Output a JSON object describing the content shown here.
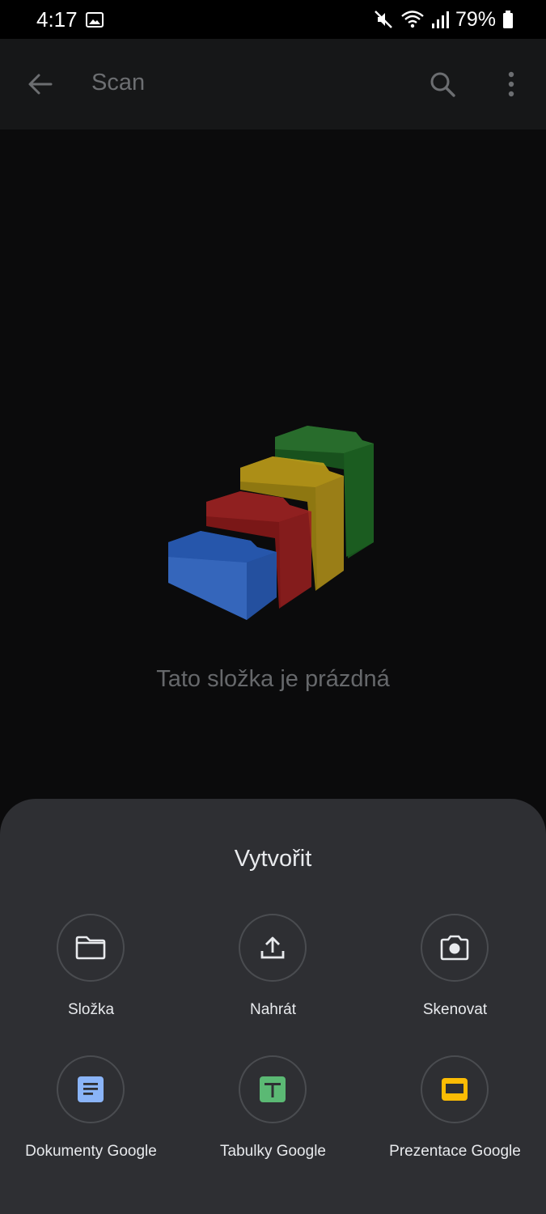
{
  "status_bar": {
    "time": "4:17",
    "battery": "79%",
    "icons": [
      "image-icon",
      "mute-icon",
      "wifi-icon",
      "signal-icon",
      "battery-icon"
    ]
  },
  "app_bar": {
    "title": "Scan",
    "icons": [
      "back-arrow-icon",
      "search-icon",
      "more-vert-icon"
    ]
  },
  "empty_state": {
    "illustration": "empty-folders-illustration",
    "message": "Tato složka je prázdná"
  },
  "sheet": {
    "title": "Vytvořit",
    "options": [
      {
        "label": "Složka",
        "icon": "folder-icon"
      },
      {
        "label": "Nahrát",
        "icon": "upload-icon"
      },
      {
        "label": "Skenovat",
        "icon": "camera-icon"
      },
      {
        "label": "Dokumenty Google",
        "icon": "google-docs-icon"
      },
      {
        "label": "Tabulky Google",
        "icon": "google-sheets-icon"
      },
      {
        "label": "Prezentace Google",
        "icon": "google-slides-icon"
      }
    ]
  },
  "colors": {
    "docs_blue": "#8ab4f8",
    "sheets_green": "#5bb974",
    "slides_yellow": "#fbbc04",
    "sheet_bg": "#2e2f33"
  }
}
